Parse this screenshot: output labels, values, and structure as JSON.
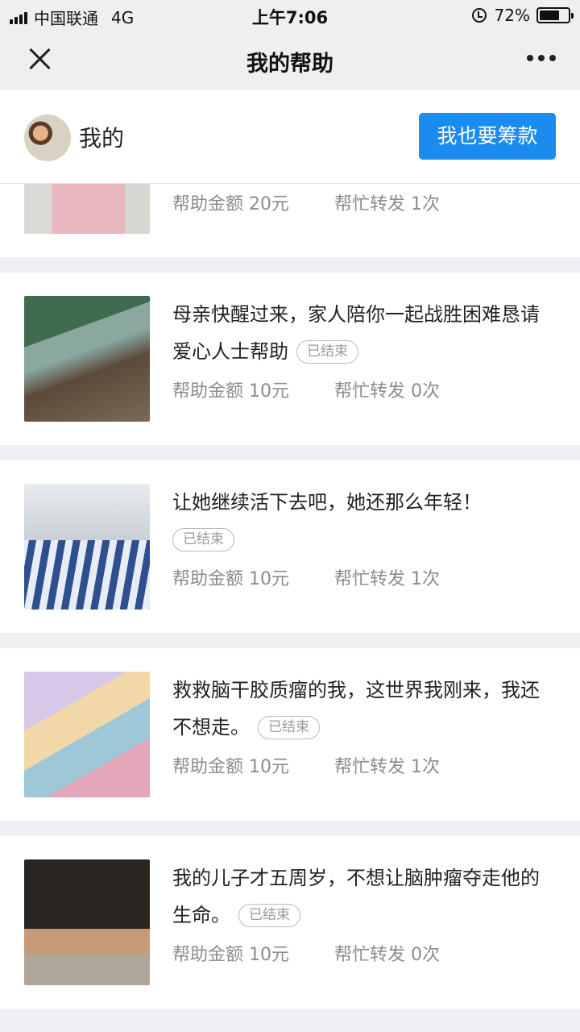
{
  "status_bar": {
    "carrier": "中国联通",
    "network": "4G",
    "time": "上午7:06",
    "battery": "72%",
    "battery_level": 0.72
  },
  "nav": {
    "title": "我的帮助",
    "close_icon": "close-icon",
    "more_icon": "more-icon"
  },
  "me": {
    "label": "我的",
    "raise_button": "我也要筹款"
  },
  "tag_label": "已结束",
  "cards": [
    {
      "title": "",
      "ended": false,
      "amount": "帮助金额 20元",
      "shares": "帮忙转发 1次"
    },
    {
      "title": "母亲快醒过来，家人陪你一起战胜困难恳请爱心人士帮助",
      "ended": true,
      "amount": "帮助金额 10元",
      "shares": "帮忙转发 0次"
    },
    {
      "title": "让她继续活下去吧，她还那么年轻！",
      "ended": true,
      "amount": "帮助金额 10元",
      "shares": "帮忙转发 1次"
    },
    {
      "title": "救救脑干胶质瘤的我，这世界我刚来，我还不想走。",
      "ended": true,
      "amount": "帮助金额 10元",
      "shares": "帮忙转发 1次"
    },
    {
      "title": "我的儿子才五周岁，不想让脑肿瘤夺走他的生命。",
      "ended": true,
      "amount": "帮助金额 10元",
      "shares": "帮忙转发 0次"
    }
  ]
}
